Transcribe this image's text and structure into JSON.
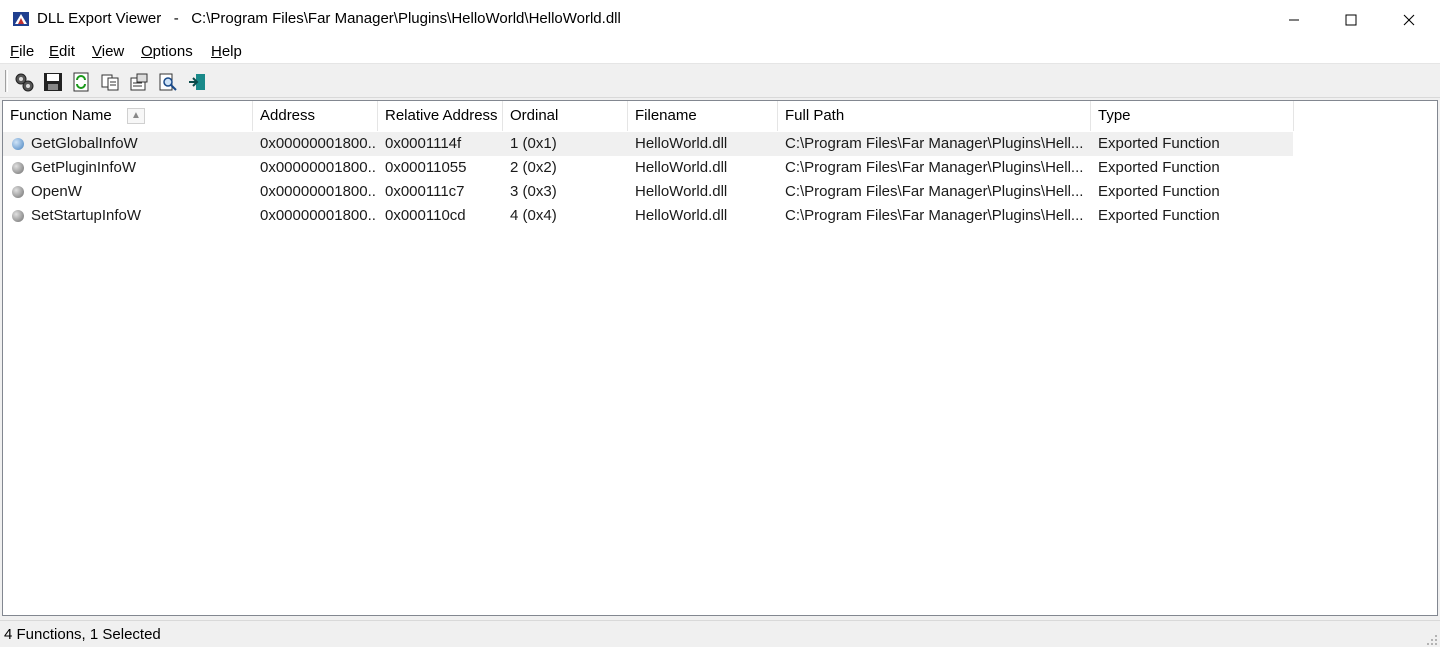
{
  "window": {
    "title": "DLL Export Viewer   -   C:\\Program Files\\Far Manager\\Plugins\\HelloWorld\\HelloWorld.dll",
    "icon": "app-icon"
  },
  "menu": [
    "File",
    "Edit",
    "View",
    "Options",
    "Help"
  ],
  "toolbar": {
    "buttons": [
      "properties-icon",
      "save-icon",
      "refresh-icon",
      "copy-icon",
      "html-report-icon",
      "find-icon",
      "exit-icon"
    ]
  },
  "columns": [
    "Function Name",
    "Address",
    "Relative Address",
    "Ordinal",
    "Filename",
    "Full Path",
    "Type"
  ],
  "rows": [
    {
      "name": "GetGlobalInfoW",
      "address": "0x00000001800...",
      "relative": "0x0001114f",
      "ordinal": "1 (0x1)",
      "filename": "HelloWorld.dll",
      "path": "C:\\Program Files\\Far Manager\\Plugins\\Hell...",
      "type": "Exported Function",
      "selected": true
    },
    {
      "name": "GetPluginInfoW",
      "address": "0x00000001800...",
      "relative": "0x00011055",
      "ordinal": "2 (0x2)",
      "filename": "HelloWorld.dll",
      "path": "C:\\Program Files\\Far Manager\\Plugins\\Hell...",
      "type": "Exported Function",
      "selected": false
    },
    {
      "name": "OpenW",
      "address": "0x00000001800...",
      "relative": "0x000111c7",
      "ordinal": "3 (0x3)",
      "filename": "HelloWorld.dll",
      "path": "C:\\Program Files\\Far Manager\\Plugins\\Hell...",
      "type": "Exported Function",
      "selected": false
    },
    {
      "name": "SetStartupInfoW",
      "address": "0x00000001800...",
      "relative": "0x000110cd",
      "ordinal": "4 (0x4)",
      "filename": "HelloWorld.dll",
      "path": "C:\\Program Files\\Far Manager\\Plugins\\Hell...",
      "type": "Exported Function",
      "selected": false
    }
  ],
  "status": "4 Functions, 1 Selected"
}
